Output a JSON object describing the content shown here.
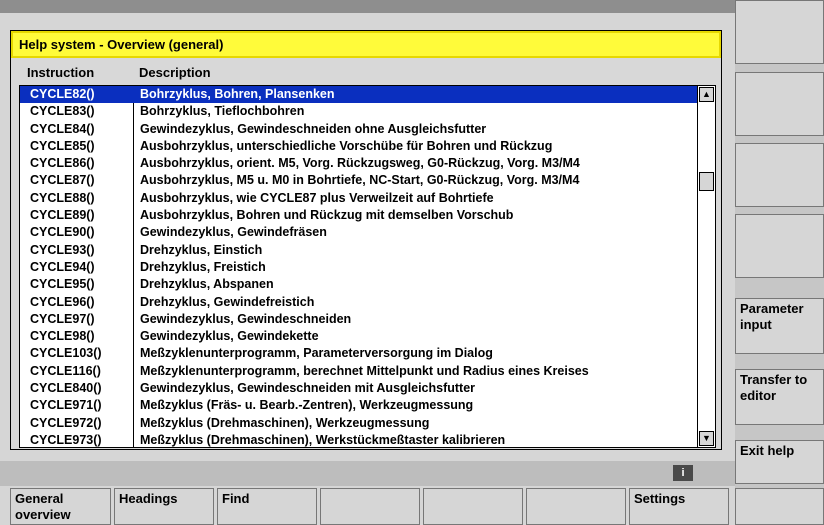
{
  "dialog": {
    "title": "Help system - Overview (general)",
    "col_instruction": "Instruction",
    "col_description": "Description",
    "rows": [
      {
        "instr": "CYCLE82()",
        "desc": "Bohrzyklus, Bohren, Plansenken"
      },
      {
        "instr": "CYCLE83()",
        "desc": "Bohrzyklus, Tieflochbohren"
      },
      {
        "instr": "CYCLE84()",
        "desc": "Gewindezyklus, Gewindeschneiden ohne Ausgleichsfutter"
      },
      {
        "instr": "CYCLE85()",
        "desc": "Ausbohrzyklus, unterschiedliche Vorschübe für Bohren und Rückzug"
      },
      {
        "instr": "CYCLE86()",
        "desc": "Ausbohrzyklus, orient. M5, Vorg. Rückzugsweg, G0-Rückzug, Vorg. M3/M4"
      },
      {
        "instr": "CYCLE87()",
        "desc": "Ausbohrzyklus, M5 u. M0 in Bohrtiefe, NC-Start, G0-Rückzug, Vorg. M3/M4"
      },
      {
        "instr": "CYCLE88()",
        "desc": "Ausbohrzyklus, wie CYCLE87 plus Verweilzeit auf Bohrtiefe"
      },
      {
        "instr": "CYCLE89()",
        "desc": "Ausbohrzyklus, Bohren und Rückzug mit demselben Vorschub"
      },
      {
        "instr": "CYCLE90()",
        "desc": "Gewindezyklus, Gewindefräsen"
      },
      {
        "instr": "CYCLE93()",
        "desc": "Drehzyklus, Einstich"
      },
      {
        "instr": "CYCLE94()",
        "desc": "Drehzyklus, Freistich"
      },
      {
        "instr": "CYCLE95()",
        "desc": "Drehzyklus, Abspanen"
      },
      {
        "instr": "CYCLE96()",
        "desc": "Drehzyklus, Gewindefreistich"
      },
      {
        "instr": "CYCLE97()",
        "desc": "Gewindezyklus, Gewindeschneiden"
      },
      {
        "instr": "CYCLE98()",
        "desc": "Gewindezyklus, Gewindekette"
      },
      {
        "instr": "CYCLE103()",
        "desc": "Meßzyklenunterprogramm, Parameterversorgung im Dialog"
      },
      {
        "instr": "CYCLE116()",
        "desc": "Meßzyklenunterprogramm, berechnet Mittelpunkt und Radius eines Kreises"
      },
      {
        "instr": "CYCLE840()",
        "desc": "Gewindezyklus, Gewindeschneiden mit Ausgleichsfutter"
      },
      {
        "instr": "CYCLE971()",
        "desc": "Meßzyklus (Fräs- u. Bearb.-Zentren), Werkzeugmessung"
      },
      {
        "instr": "CYCLE972()",
        "desc": "Meßzyklus (Drehmaschinen), Werkzeugmessung"
      },
      {
        "instr": "CYCLE973()",
        "desc": "Meßzyklus (Drehmaschinen), Werkstückmeßtaster kalibrieren"
      }
    ]
  },
  "info_label": "i",
  "vertical_softkeys": {
    "parameter_input": "Parameter input",
    "transfer_to_editor": "Transfer to editor",
    "exit_help": "Exit help"
  },
  "horizontal_softkeys": {
    "general_overview": "General overview",
    "headings": "Headings",
    "find": "Find",
    "settings": "Settings"
  },
  "colors": {
    "title_bg": "#fffb3a",
    "selection_bg": "#0a2fbf"
  }
}
